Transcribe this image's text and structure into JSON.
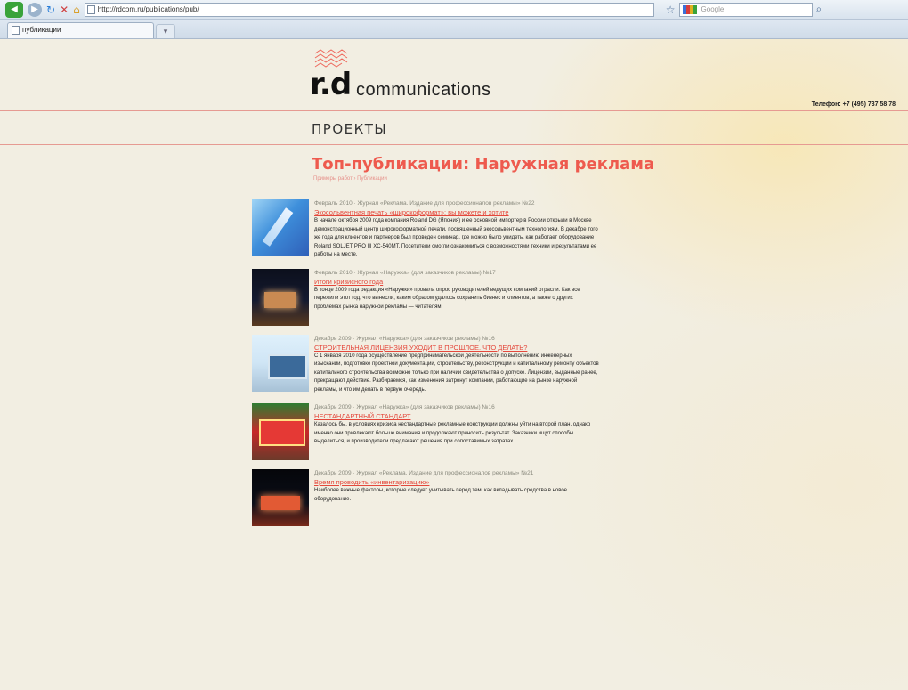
{
  "browser": {
    "url": "http://rdcom.ru/publications/pub/",
    "tab_title": "публикации",
    "search_placeholder": "Google",
    "icons": {
      "back": "back-arrow-icon",
      "forward": "forward-arrow-icon",
      "refresh": "refresh-icon",
      "stop": "stop-icon",
      "home": "home-icon"
    }
  },
  "brand": {
    "logo_mark": "r.d",
    "logo_text": "communications",
    "phone": "Телефон: +7 (495) 737 58 78",
    "accent_color": "#ee5a4e"
  },
  "section": {
    "title": "ПРОЕКТЫ"
  },
  "heading": {
    "title": "Топ-публикации: Наружная реклама",
    "subtitle": "Примеры работ › Публикации"
  },
  "articles": [
    {
      "meta": "Февраль 2010 · Журнал «Реклама. Издание для профессионалов рекламы» №22",
      "title": "Экосольвентная печать «широкоформат»: вы можете и хотите",
      "text": "В начале октября 2009 года компания Roland DG (Япония) и ее основной импортер в России открыли в Москве демонстрационный центр широкоформатной печати, посвященный экосольвентным технологиям. В декабре того же года для клиентов и партнеров был проведен семинар, где можно было увидеть, как работает оборудование Roland SOLJET PRO III XC-540MT. Посетители смогли ознакомиться с возможностями техники и результатами ее работы на месте."
    },
    {
      "meta": "Февраль 2010 · Журнал «Наружка» (для заказчиков рекламы) №17",
      "title": "Итоги кризисного года",
      "text": "В конце 2009 года редакция «Наружки» провела опрос руководителей ведущих компаний отрасли. Как все пережили этот год, что вынесли, каким образом удалось сохранить бизнес и клиентов, а также о других проблемах рынка наружной рекламы — читателям."
    },
    {
      "meta": "Декабрь 2009 · Журнал «Наружка» (для заказчиков рекламы) №16",
      "title": "СТРОИТЕЛЬНАЯ ЛИЦЕНЗИЯ УХОДИТ В ПРОШЛОЕ. ЧТО ДЕЛАТЬ?",
      "text": "С 1 января 2010 года осуществление предпринимательской деятельности по выполнению инженерных изысканий, подготовке проектной документации, строительству, реконструкции и капитальному ремонту объектов капитального строительства возможно только при наличии свидетельства о допуске. Лицензии, выданные ранее, прекращают действие. Разбираемся, как изменения затронут компании, работающие на рынке наружной рекламы, и что им делать в первую очередь."
    },
    {
      "meta": "Декабрь 2009 · Журнал «Наружка» (для заказчиков рекламы) №16",
      "title": "НЕСТАНДАРТНЫЙ СТАНДАРТ",
      "text": "Казалось бы, в условиях кризиса нестандартные рекламные конструкции должны уйти на второй план, однако именно они привлекают больше внимания и продолжают приносить результат. Заказчики ищут способы выделиться, и производители предлагают решения при сопоставимых затратах."
    },
    {
      "meta": "Декабрь 2009 · Журнал «Реклама. Издание для профессионалов рекламы» №21",
      "title": "Время проводить «инвентаризацию»",
      "text": "Наиболее важные факторы, которые следует учитывать перед тем, как вкладывать средства в новое оборудование."
    }
  ]
}
